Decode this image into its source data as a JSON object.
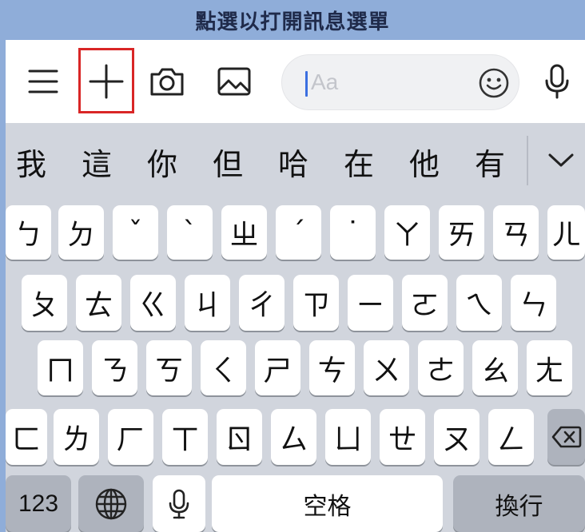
{
  "caption": "點選以打開訊息選單",
  "toolbar": {
    "input_placeholder": "Aa"
  },
  "candidates": [
    "我",
    "這",
    "你",
    "但",
    "哈",
    "在",
    "他",
    "有"
  ],
  "keyboard": {
    "row1": [
      "ㄅ",
      "ㄉ",
      "ˇ",
      "ˋ",
      "ㄓ",
      "ˊ",
      "˙",
      "ㄚ",
      "ㄞ",
      "ㄢ",
      "ㄦ"
    ],
    "row2": [
      "ㄆ",
      "ㄊ",
      "ㄍ",
      "ㄐ",
      "ㄔ",
      "ㄗ",
      "ㄧ",
      "ㄛ",
      "ㄟ",
      "ㄣ"
    ],
    "row3": [
      "ㄇ",
      "ㄋ",
      "ㄎ",
      "ㄑ",
      "ㄕ",
      "ㄘ",
      "ㄨ",
      "ㄜ",
      "ㄠ",
      "ㄤ"
    ],
    "row4": [
      "ㄈ",
      "ㄌ",
      "ㄏ",
      "ㄒ",
      "ㄖ",
      "ㄙ",
      "ㄩ",
      "ㄝ",
      "ㄡ",
      "ㄥ"
    ],
    "numbers_label": "123",
    "space_label": "空格",
    "return_label": "換行"
  },
  "colors": {
    "highlight": "#d92626",
    "caret": "#3b6fe0",
    "caption_bg": "#8fadd9"
  },
  "icons": [
    "menu-icon",
    "plus-icon",
    "camera-icon",
    "image-icon",
    "emoji-icon",
    "microphone-icon",
    "chevron-down-icon",
    "globe-icon",
    "backspace-icon"
  ]
}
